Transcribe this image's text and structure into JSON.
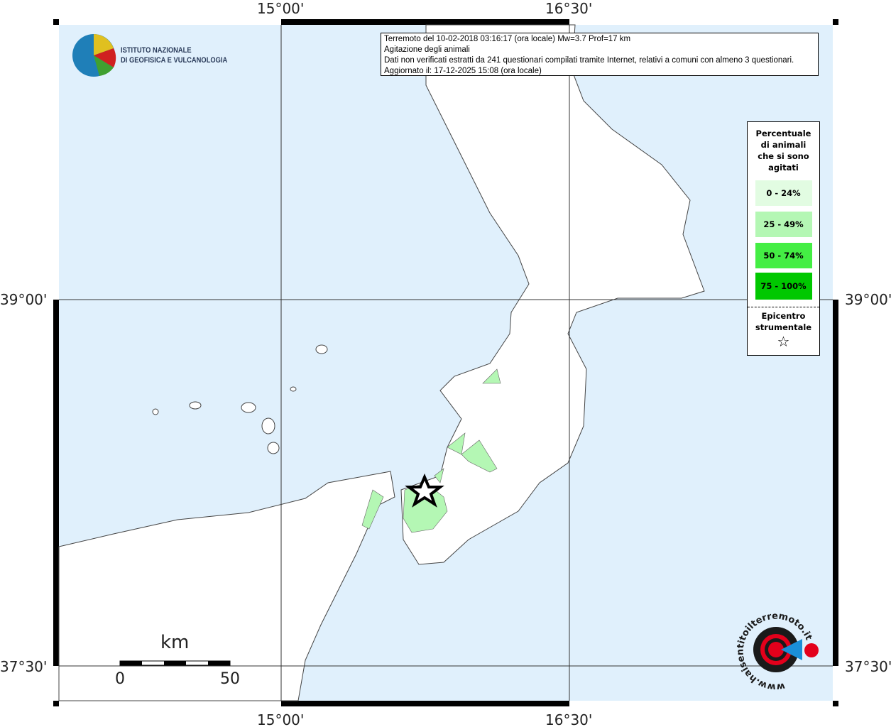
{
  "info_box": {
    "line1": "Terremoto del 10-02-2018 03:16:17 (ora locale) Mw=3.7 Prof=17 km",
    "line2": "Agitazione degli animali",
    "line3": "Dati non verificati estratti da 241 questionari compilati tramite Internet, relativi a comuni con almeno 3 questionari.",
    "line4": "Aggiornato il: 17-12-2025 15:08 (ora locale)"
  },
  "logo": {
    "line1": "ISTITUTO NAZIONALE",
    "line2": "DI GEOFISICA E VULCANOLOGIA"
  },
  "axes": {
    "lon1": "15°00'",
    "lon2": "16°30'",
    "lat1": "39°00'",
    "lat2": "37°30'"
  },
  "legend": {
    "title": [
      "Percentuale",
      "di animali",
      "che si sono",
      "agitati"
    ],
    "classes": [
      {
        "label": "0 - 24%",
        "color": "#e2fce2"
      },
      {
        "label": "25 - 49%",
        "color": "#b4f7b4"
      },
      {
        "label": "50 - 74%",
        "color": "#44ee44"
      },
      {
        "label": "75 - 100%",
        "color": "#00c800"
      }
    ],
    "epicenter_label": [
      "Epicentro",
      "strumentale"
    ],
    "epicenter_symbol": "☆"
  },
  "scale": {
    "unit": "km",
    "start": "0",
    "end": "50"
  },
  "watermark": "www.haisentitoilterremoto.it",
  "colors": {
    "sea": "#e0f0fc",
    "land": "#ffffff",
    "affected": "#b4f7b4"
  }
}
